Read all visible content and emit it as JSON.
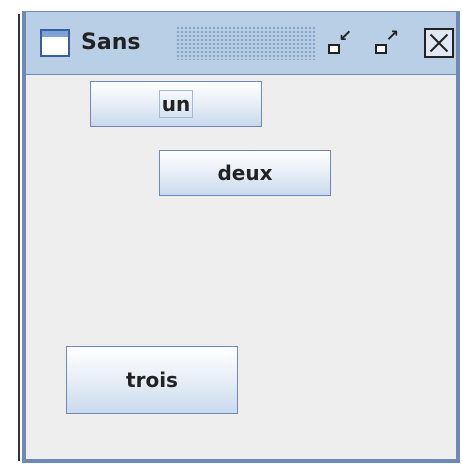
{
  "window": {
    "title": "Sans",
    "controls": {
      "iconify_icon": "iconify-icon",
      "maximize_icon": "maximize-icon",
      "close_icon": "close-icon"
    }
  },
  "buttons": {
    "un": "un",
    "deux": "deux",
    "trois": "trois"
  },
  "colors": {
    "titlebar": "#b8cfe5",
    "border": "#6f88b5",
    "content_bg": "#eeeeee"
  }
}
